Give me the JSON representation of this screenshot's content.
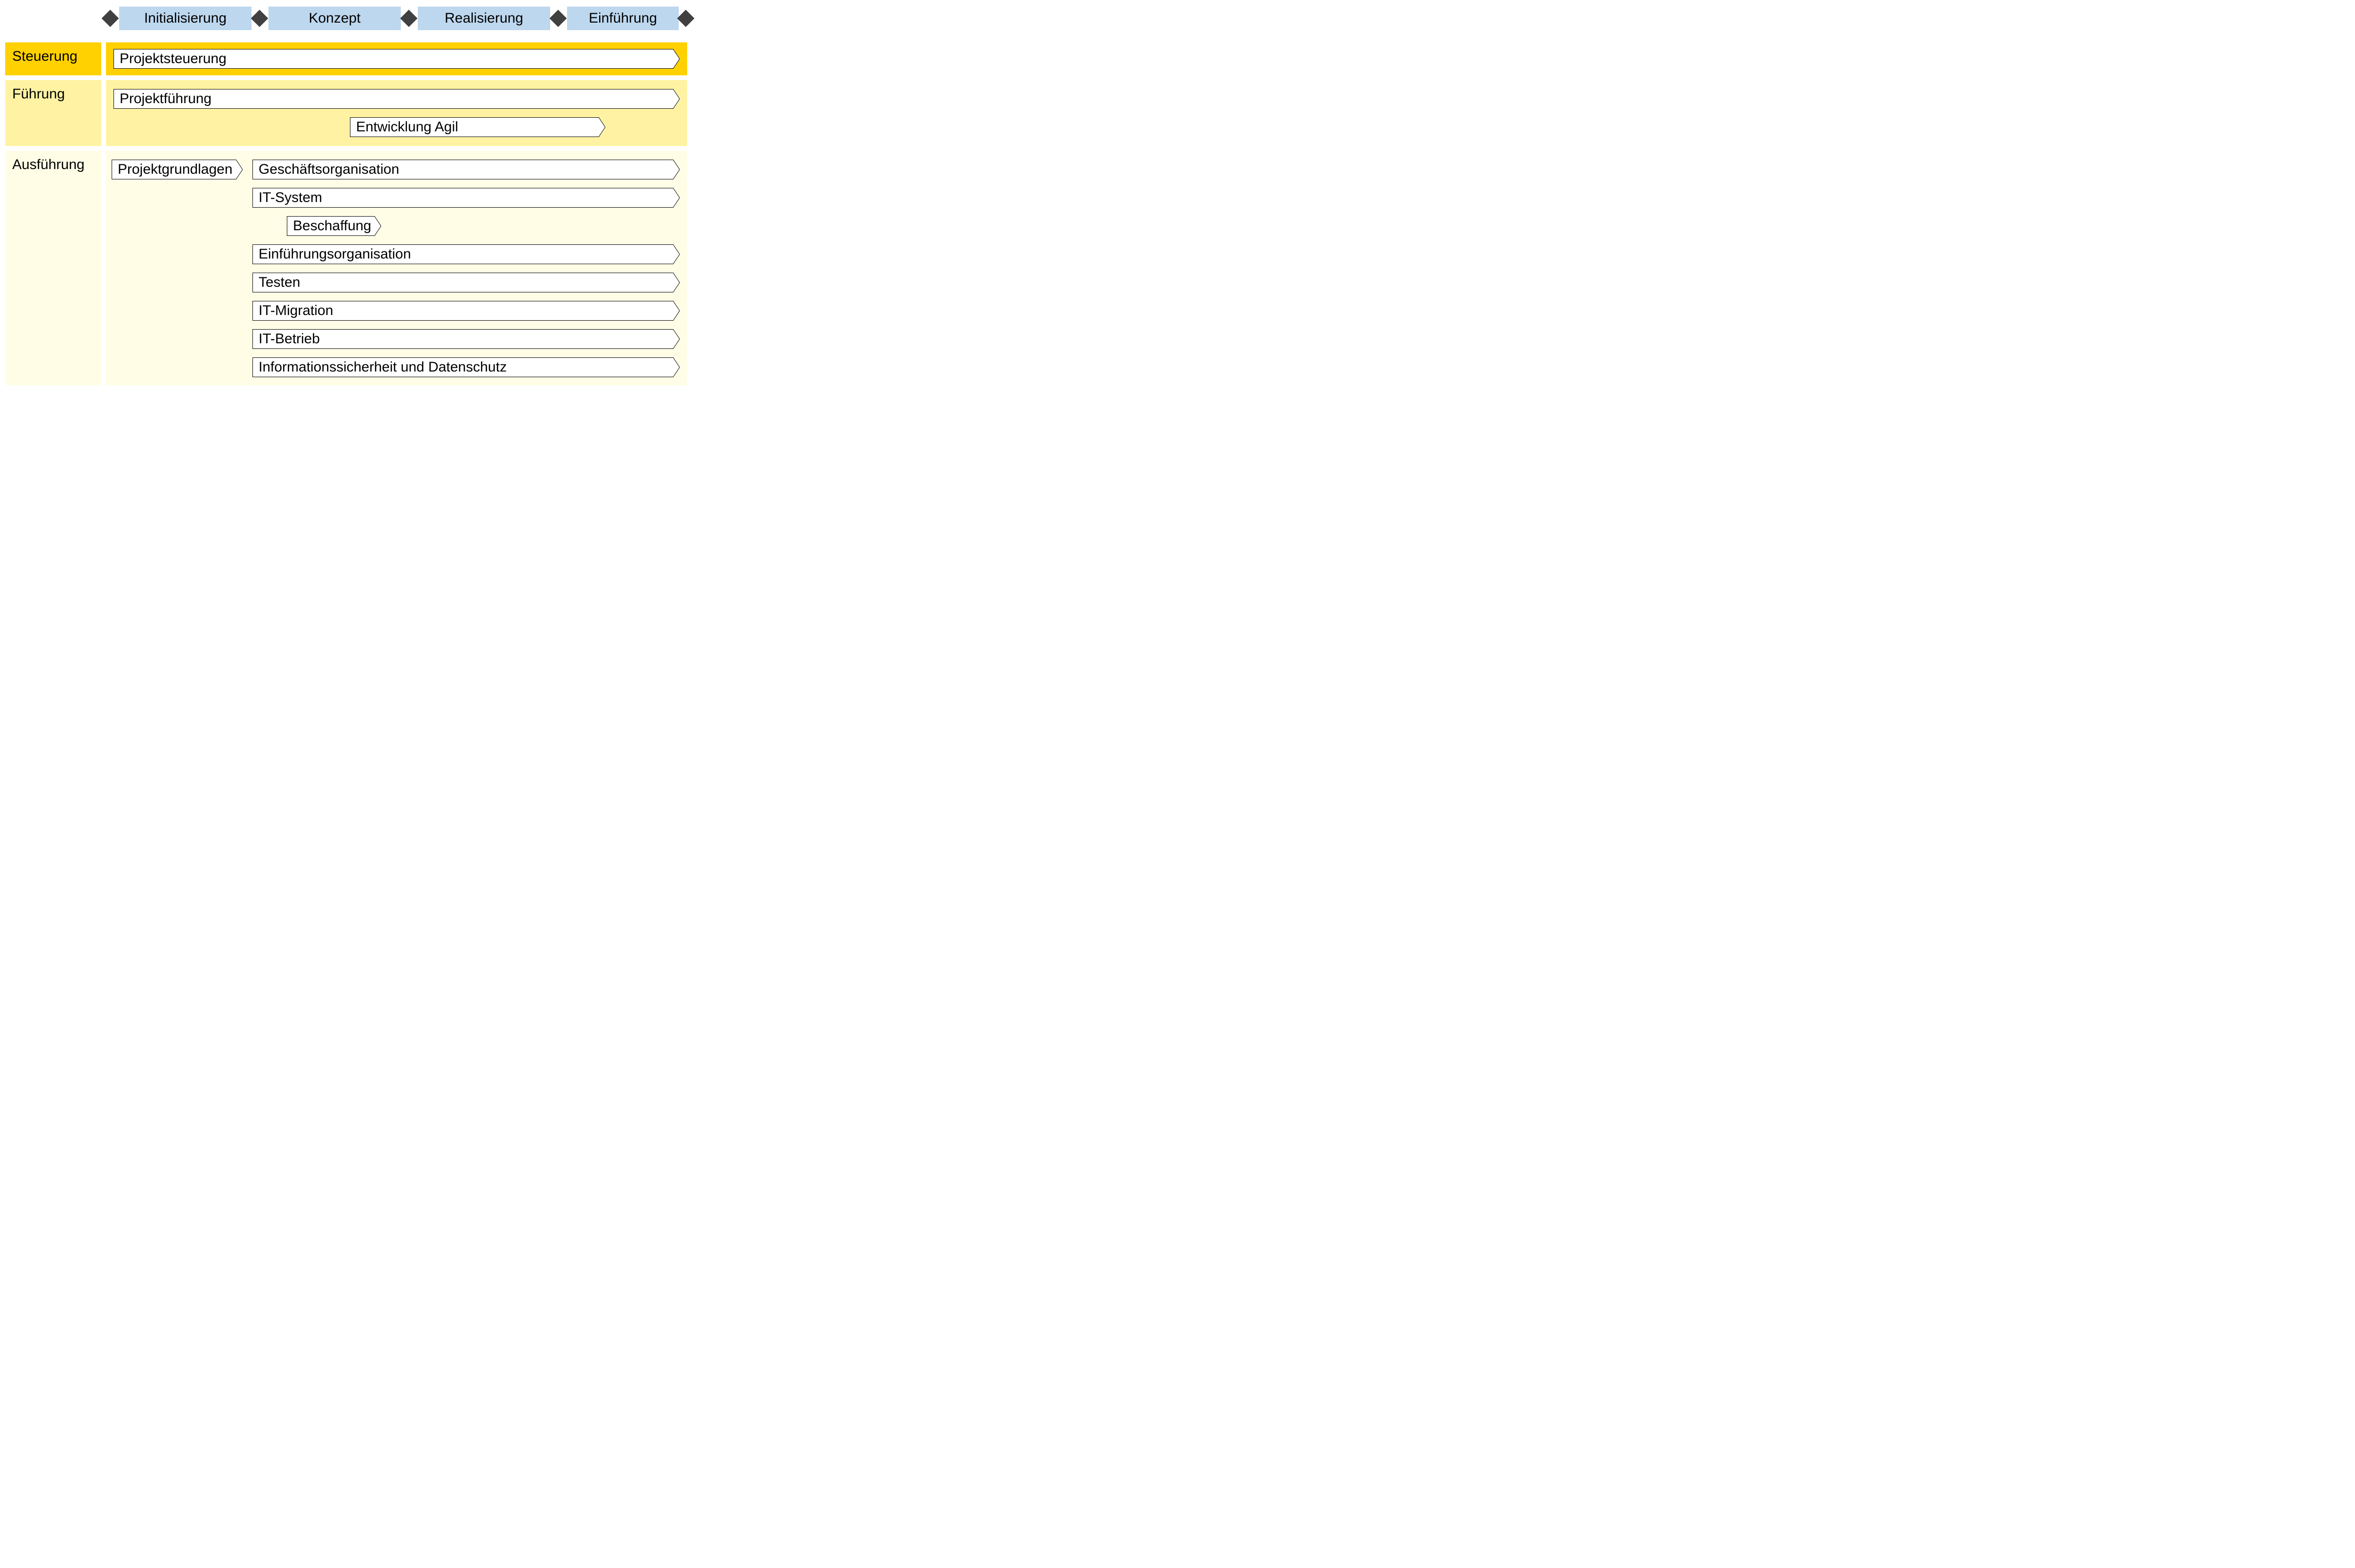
{
  "phases": {
    "p1": "Initialisierung",
    "p2": "Konzept",
    "p3": "Realisierung",
    "p4": "Einführung"
  },
  "rows": {
    "steuerung": {
      "label": "Steuerung"
    },
    "fuehrung": {
      "label": "Führung"
    },
    "ausfuehrung": {
      "label": "Ausführung"
    }
  },
  "bars": {
    "projektsteuerung": "Projektsteuerung",
    "projektfuehrung": "Projektführung",
    "entwicklung_agil": "Entwicklung Agil",
    "projektgrundlagen": "Projektgrundlagen",
    "geschaeftsorg": "Geschäftsorganisation",
    "it_system": "IT-System",
    "beschaffung": "Beschaffung",
    "einfuehrungsorg": "Einführungsorganisation",
    "testen": "Testen",
    "it_migration": "IT-Migration",
    "it_betrieb": "IT-Betrieb",
    "infosec": "Informationssicherheit und Datenschutz"
  },
  "colors": {
    "phase_bg": "#bdd7ee",
    "diamond": "#404040",
    "steuerung_bg": "#ffd100",
    "fuehrung_bg": "#fff3a3",
    "ausf_bg": "#fffde6"
  }
}
